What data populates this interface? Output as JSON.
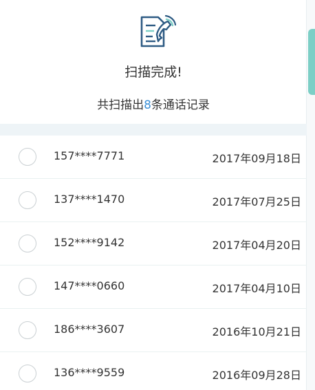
{
  "header": {
    "icon": "call-log-document-icon",
    "title": "扫描完成!",
    "summary_prefix": "共扫描出",
    "summary_count": "8",
    "summary_suffix": "条通话记录"
  },
  "colors": {
    "accent_teal": "#7ccfc6",
    "icon_blue": "#2d5a83",
    "count_blue": "#3a8fd6"
  },
  "records": [
    {
      "phone": "157****7771",
      "date": "2017年09月18日"
    },
    {
      "phone": "137****1470",
      "date": "2017年07月25日"
    },
    {
      "phone": "152****9142",
      "date": "2017年04月20日"
    },
    {
      "phone": "147****0660",
      "date": "2017年04月10日"
    },
    {
      "phone": "186****3607",
      "date": "2016年10月21日"
    },
    {
      "phone": "136****9559",
      "date": "2016年09月28日"
    }
  ]
}
